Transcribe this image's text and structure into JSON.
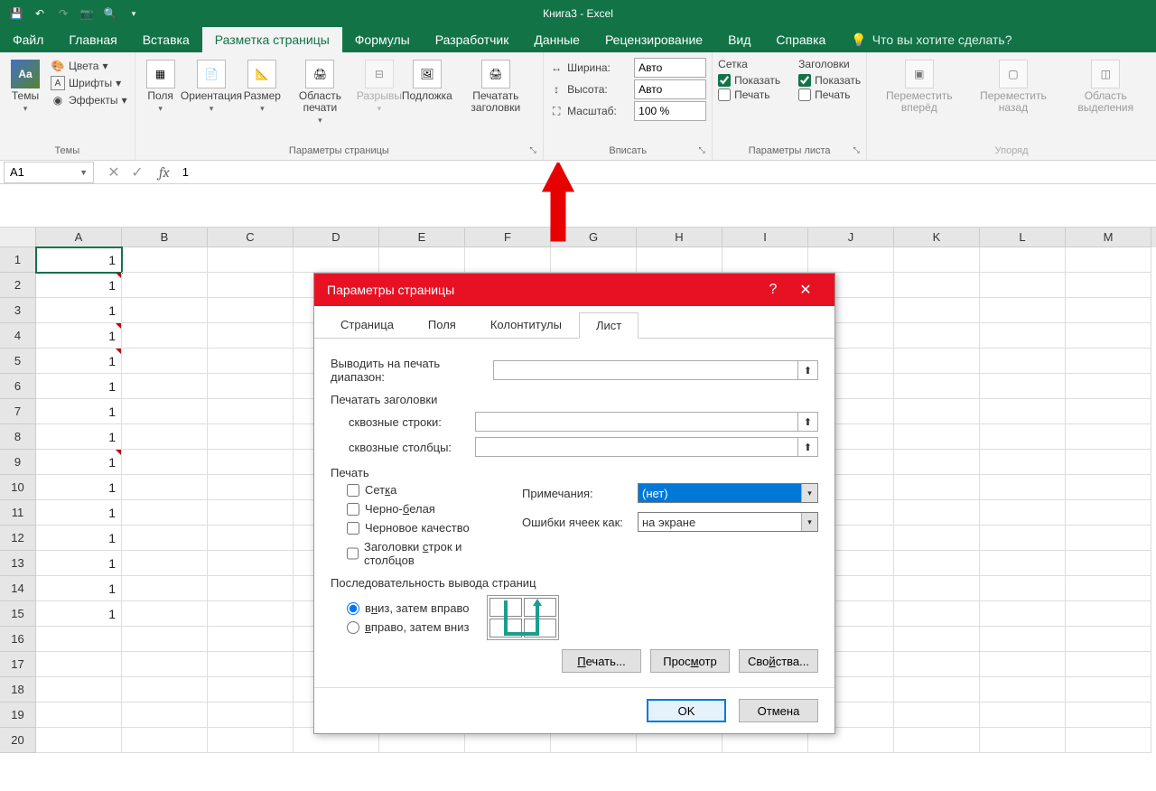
{
  "titlebar": {
    "doc_title": "Книга3  -  Excel"
  },
  "qat": {
    "save": "💾",
    "undo": "↶",
    "redo": "↷",
    "camera": "📷",
    "preview": "🔍"
  },
  "ribbon_tabs": [
    "Файл",
    "Главная",
    "Вставка",
    "Разметка страницы",
    "Формулы",
    "Разработчик",
    "Данные",
    "Рецензирование",
    "Вид",
    "Справка"
  ],
  "active_tab_index": 3,
  "tell_me": "Что вы хотите сделать?",
  "ribbon": {
    "themes": {
      "btn": "Темы",
      "colors": "Цвета",
      "fonts": "Шрифты",
      "effects": "Эффекты",
      "group": "Темы"
    },
    "page_setup": {
      "margins": "Поля",
      "orientation": "Ориентация",
      "size": "Размер",
      "print_area": "Область печати",
      "breaks": "Разрывы",
      "background": "Подложка",
      "print_titles": "Печатать заголовки",
      "group": "Параметры страницы"
    },
    "fit": {
      "width_label": "Ширина:",
      "width_val": "Авто",
      "height_label": "Высота:",
      "height_val": "Авто",
      "scale_label": "Масштаб:",
      "scale_val": "100 %",
      "group": "Вписать"
    },
    "sheet_opts": {
      "grid": "Сетка",
      "headings": "Заголовки",
      "show": "Показать",
      "print": "Печать",
      "group": "Параметры листа",
      "grid_show": true,
      "grid_print": false,
      "head_show": true,
      "head_print": false
    },
    "arrange": {
      "bring_forward": "Переместить вперёд",
      "send_backward": "Переместить назад",
      "selection_pane": "Область выделения",
      "group": "Упоряд"
    }
  },
  "name_box": "A1",
  "formula_value": "1",
  "cols": [
    "A",
    "B",
    "C",
    "D",
    "E",
    "F",
    "G",
    "H",
    "I",
    "J",
    "K",
    "L",
    "M"
  ],
  "rows": [
    1,
    2,
    3,
    4,
    5,
    6,
    7,
    8,
    9,
    10,
    11,
    12,
    13,
    14,
    15,
    16,
    17,
    18,
    19,
    20
  ],
  "cell_values": {
    "A1": "1",
    "A2": "1",
    "A3": "1",
    "A4": "1",
    "A5": "1",
    "A6": "1",
    "A7": "1",
    "A8": "1",
    "A9": "1",
    "A10": "1",
    "A11": "1",
    "A12": "1",
    "A13": "1",
    "A14": "1",
    "A15": "1"
  },
  "comment_cells": [
    "A2",
    "A4",
    "A5",
    "A9"
  ],
  "selected_cell": "A1",
  "dialog": {
    "title": "Параметры страницы",
    "tabs": [
      "Страница",
      "Поля",
      "Колонтитулы",
      "Лист"
    ],
    "active_tab_index": 3,
    "print_range_label": "Выводить на печать диапазон:",
    "print_titles_label": "Печатать заголовки",
    "rows_repeat_label": "сквозные строки:",
    "cols_repeat_label": "сквозные столбцы:",
    "print_section": "Печать",
    "chk_grid": "Сетка",
    "chk_bw": "Черно-белая",
    "chk_draft": "Черновое качество",
    "chk_headings": "Заголовки строк и столбцов",
    "comments_label": "Примечания:",
    "comments_val": "(нет)",
    "errors_label": "Ошибки ячеек как:",
    "errors_val": "на экране",
    "order_section": "Последовательность вывода страниц",
    "order_down": "вниз, затем вправо",
    "order_over": "вправо, затем вниз",
    "print_btn": "Печать...",
    "preview_btn": "Просмотр",
    "props_btn": "Свойства...",
    "ok": "OK",
    "cancel": "Отмена"
  }
}
